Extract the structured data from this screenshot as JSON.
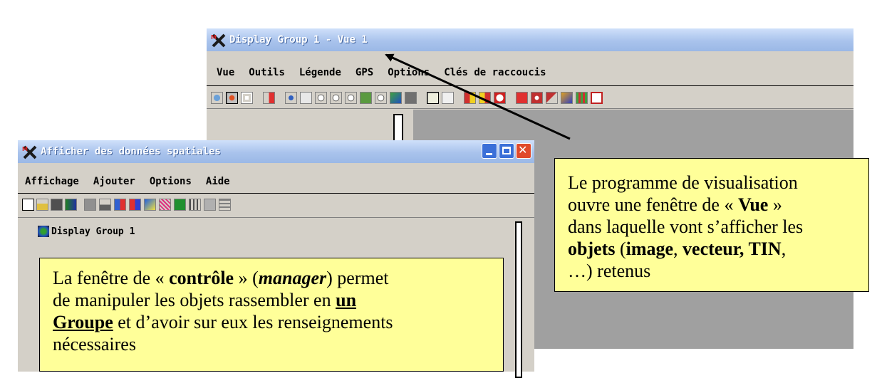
{
  "display_window": {
    "title": "Display Group 1 - Vue 1",
    "menu": [
      "Vue",
      "Outils",
      "Légende",
      "GPS",
      "Options",
      "Clés de raccoucis"
    ],
    "toolbar_icons": [
      "redraw-icon",
      "redraw-once-icon",
      "frame-icon",
      "add-layer-icon",
      "pan-icon",
      "zoom-box-icon",
      "zoom-in-icon",
      "zoom-out-icon",
      "zoom-full-icon",
      "zoom-grid-icon",
      "zoom-scale-icon",
      "view-pan-icon",
      "snapshot-icon",
      "zoom-1x1-icon",
      "scale-icon",
      "prev-view-icon",
      "next-view-icon",
      "stop-icon",
      "zoom-active-icon",
      "gps-icon",
      "select-arrow-icon",
      "legend-icon",
      "grid-icon",
      "window-icon"
    ]
  },
  "manager_window": {
    "title": "Afficher des données spatiales",
    "menu": [
      "Affichage",
      "Ajouter",
      "Options",
      "Aide"
    ],
    "toolbar_icons": [
      "new-icon",
      "open-icon",
      "save-icon",
      "layout-icon",
      "layer-icon",
      "terrain-icon",
      "add-layer-icon",
      "raster-icon",
      "vector-icon",
      "shape-icon",
      "tin-icon",
      "cad-icon",
      "db-icon",
      "table-icon"
    ],
    "tree_item": "Display Group 1"
  },
  "callout_view": {
    "line1": "Le programme de visualisation",
    "line2_a": "ouvre une fenêtre de « ",
    "line2_b": "Vue",
    "line2_c": " »",
    "line3": "dans laquelle vont s’afficher les",
    "line4_a": "objets",
    "line4_b": " (",
    "line4_c": "image",
    "line4_d": ", ",
    "line4_e": "vecteur, TIN",
    "line4_f": ",",
    "line5": "…)  retenus"
  },
  "callout_manager": {
    "line1_a": "La fenêtre de « ",
    "line1_b": "contrôle",
    "line1_c": " » (",
    "line1_d": "manager",
    "line1_e": ") permet",
    "line2_a": "de manipuler les objets rassembler en ",
    "line2_b": "un",
    "line3_a": "Groupe",
    "line3_b": " et d’avoir sur eux les renseignements",
    "line4": "nécessaires"
  },
  "colors": {
    "title_gradient": "#a9c3ec",
    "callout_bg": "#ffff99",
    "view_canvas": "#a0a0a0",
    "window_bg": "#d4d0c8",
    "close_button": "#e04a2b"
  }
}
